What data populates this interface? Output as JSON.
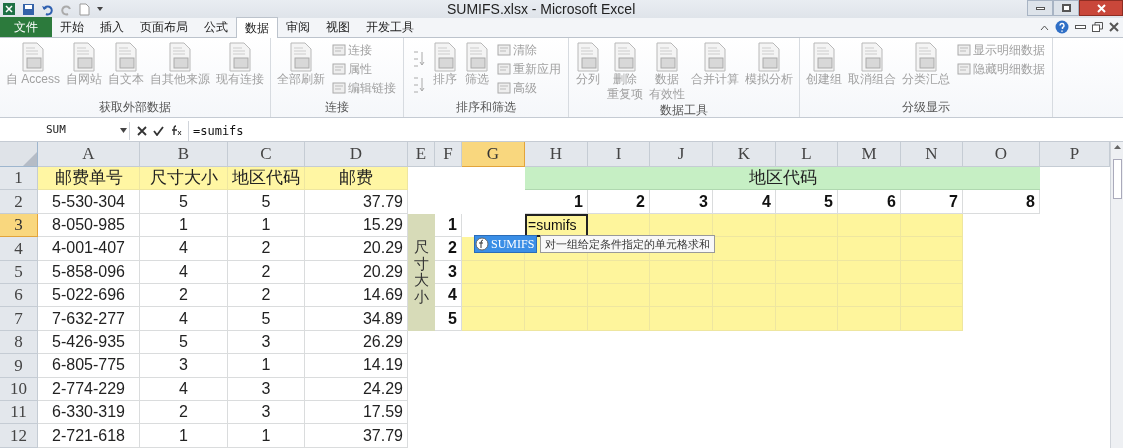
{
  "window": {
    "title": "SUMIFS.xlsx - Microsoft Excel"
  },
  "tabs": [
    {
      "label": "文件",
      "kind": "file",
      "selected": false
    },
    {
      "label": "开始",
      "kind": "tab",
      "selected": false
    },
    {
      "label": "插入",
      "kind": "tab",
      "selected": false
    },
    {
      "label": "页面布局",
      "kind": "tab",
      "selected": false
    },
    {
      "label": "公式",
      "kind": "tab",
      "selected": false
    },
    {
      "label": "数据",
      "kind": "tab",
      "selected": true
    },
    {
      "label": "审阅",
      "kind": "tab",
      "selected": false
    },
    {
      "label": "视图",
      "kind": "tab",
      "selected": false
    },
    {
      "label": "开发工具",
      "kind": "tab",
      "selected": false
    }
  ],
  "ribbon": {
    "disabled": true,
    "groups": [
      {
        "label": "获取外部数据",
        "items": [
          {
            "kind": "large",
            "lines": [
              "自 Access"
            ]
          },
          {
            "kind": "large",
            "lines": [
              "自网站"
            ]
          },
          {
            "kind": "large",
            "lines": [
              "自文本"
            ]
          },
          {
            "kind": "large",
            "lines": [
              "自其他来源"
            ]
          },
          {
            "kind": "large",
            "lines": [
              "现有连接"
            ]
          }
        ]
      },
      {
        "label": "连接",
        "items": [
          {
            "kind": "large",
            "lines": [
              "全部刷新"
            ]
          },
          {
            "kind": "stack",
            "lines": [
              "连接",
              "属性",
              "编辑链接"
            ]
          }
        ]
      },
      {
        "label": "排序和筛选",
        "items": [
          {
            "kind": "sorticons"
          },
          {
            "kind": "large",
            "lines": [
              "排序"
            ]
          },
          {
            "kind": "large",
            "lines": [
              "筛选"
            ]
          },
          {
            "kind": "stack",
            "lines": [
              "清除",
              "重新应用",
              "高级"
            ]
          }
        ]
      },
      {
        "label": "数据工具",
        "items": [
          {
            "kind": "large",
            "lines": [
              "分列"
            ]
          },
          {
            "kind": "large",
            "lines": [
              "删除",
              "重复项"
            ]
          },
          {
            "kind": "large",
            "lines": [
              "数据",
              "有效性"
            ]
          },
          {
            "kind": "large",
            "lines": [
              "合并计算"
            ]
          },
          {
            "kind": "large",
            "lines": [
              "模拟分析"
            ]
          }
        ]
      },
      {
        "label": "分级显示",
        "items": [
          {
            "kind": "large",
            "lines": [
              "创建组"
            ]
          },
          {
            "kind": "large",
            "lines": [
              "取消组合"
            ]
          },
          {
            "kind": "large",
            "lines": [
              "分类汇总"
            ]
          },
          {
            "kind": "stack",
            "lines": [
              "显示明细数据",
              "隐藏明细数据"
            ]
          }
        ]
      }
    ]
  },
  "formula_bar": {
    "name_box": "SUM",
    "formula": "=sumifs"
  },
  "columns": [
    {
      "label": "A",
      "selected": false
    },
    {
      "label": "B",
      "selected": false
    },
    {
      "label": "C",
      "selected": false
    },
    {
      "label": "D",
      "selected": false
    },
    {
      "label": "E",
      "selected": false
    },
    {
      "label": "F",
      "selected": false
    },
    {
      "label": "G",
      "selected": true
    },
    {
      "label": "H",
      "selected": false
    },
    {
      "label": "I",
      "selected": false
    },
    {
      "label": "J",
      "selected": false
    },
    {
      "label": "K",
      "selected": false
    },
    {
      "label": "L",
      "selected": false
    },
    {
      "label": "M",
      "selected": false
    },
    {
      "label": "N",
      "selected": false
    },
    {
      "label": "O",
      "selected": false
    },
    {
      "label": "P",
      "selected": false
    }
  ],
  "row_numbers": [
    {
      "label": "1",
      "selected": false
    },
    {
      "label": "2",
      "selected": false
    },
    {
      "label": "3",
      "selected": true
    },
    {
      "label": "4",
      "selected": false
    },
    {
      "label": "5",
      "selected": false
    },
    {
      "label": "6",
      "selected": false
    },
    {
      "label": "7",
      "selected": false
    },
    {
      "label": "8",
      "selected": false
    },
    {
      "label": "9",
      "selected": false
    },
    {
      "label": "10",
      "selected": false
    },
    {
      "label": "11",
      "selected": false
    },
    {
      "label": "12",
      "selected": false
    }
  ],
  "data_table": {
    "headers": [
      "邮费单号",
      "尺寸大小",
      "地区代码",
      "邮费"
    ],
    "rows": [
      [
        "5-530-304",
        "5",
        "5",
        "37.79"
      ],
      [
        "8-050-985",
        "1",
        "1",
        "15.29"
      ],
      [
        "4-001-407",
        "4",
        "2",
        "20.29"
      ],
      [
        "5-858-096",
        "4",
        "2",
        "20.29"
      ],
      [
        "5-022-696",
        "2",
        "2",
        "14.69"
      ],
      [
        "7-632-277",
        "4",
        "5",
        "34.89"
      ],
      [
        "5-426-935",
        "5",
        "3",
        "26.29"
      ],
      [
        "6-805-775",
        "3",
        "1",
        "14.19"
      ],
      [
        "2-774-229",
        "4",
        "3",
        "24.29"
      ],
      [
        "6-330-319",
        "2",
        "3",
        "17.59"
      ],
      [
        "2-721-618",
        "1",
        "1",
        "37.79"
      ]
    ]
  },
  "summary_table": {
    "region_title": "地区代码",
    "region_codes": [
      "1",
      "2",
      "3",
      "4",
      "5",
      "6",
      "7",
      "8"
    ],
    "size_title": "尺寸大小",
    "sizes": [
      "1",
      "2",
      "3",
      "4",
      "5"
    ],
    "editing_cell": "=sumifs"
  },
  "autocomplete": {
    "function": "SUMIFS",
    "description": "对一组给定条件指定的单元格求和"
  }
}
